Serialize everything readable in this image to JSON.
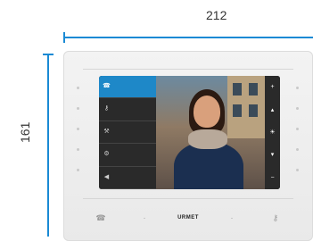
{
  "dimensions": {
    "width_label": "212",
    "height_label": "161"
  },
  "screen": {
    "menu_items": [
      {
        "label": "",
        "icon": "phone-icon",
        "glyph": "☎",
        "active": true
      },
      {
        "label": "",
        "icon": "key-icon",
        "glyph": "⚷",
        "active": false
      },
      {
        "label": "",
        "icon": "wrench-icon",
        "glyph": "⚒",
        "active": false
      },
      {
        "label": "",
        "icon": "settings-icon",
        "glyph": "⚙",
        "active": false
      },
      {
        "label": "",
        "icon": "speaker-icon",
        "glyph": "◀",
        "active": false
      }
    ],
    "right_controls": [
      {
        "icon": "plus-icon",
        "glyph": "+"
      },
      {
        "icon": "volume-up-icon",
        "glyph": "▴"
      },
      {
        "icon": "brightness-icon",
        "glyph": "☀"
      },
      {
        "icon": "volume-down-icon",
        "glyph": "▾"
      },
      {
        "icon": "minus-icon",
        "glyph": "−"
      }
    ]
  },
  "bottom": {
    "brand": "URMET",
    "buttons": [
      {
        "icon": "handset-icon",
        "glyph": "☎"
      },
      {
        "icon": "dot-icon",
        "glyph": "·"
      },
      {
        "icon": "dot-icon",
        "glyph": "·"
      },
      {
        "icon": "key-icon",
        "glyph": "⚷"
      }
    ]
  },
  "colors": {
    "accent": "#1e88c8",
    "dimension_line": "#1a8ad4"
  }
}
